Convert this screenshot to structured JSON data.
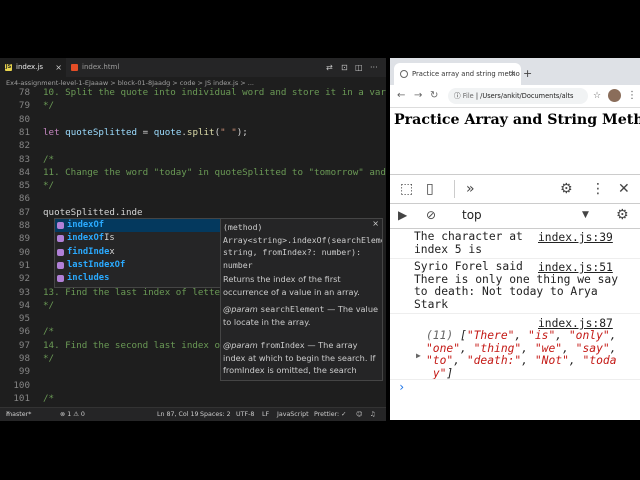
{
  "vscode": {
    "tabs": [
      "index.js",
      "index.html"
    ],
    "breadcrumb": "Ex4-assignment-level-1-EJaaaw  >  block-01-8Jaadg  >  code  >  JS  index.js  >  ...",
    "lines": [
      {
        "n": "78",
        "t": "10. Split the quote into individual word and store it in a vari"
      },
      {
        "n": "79",
        "t": "*/"
      },
      {
        "n": "80",
        "t": ""
      },
      {
        "n": "81",
        "t": ""
      },
      {
        "n": "82",
        "t": ""
      },
      {
        "n": "83",
        "t": "/*"
      },
      {
        "n": "84",
        "t": "11. Change the word \"today\" in quoteSplitted to \"tomorrow\" and"
      },
      {
        "n": "85",
        "t": "*/"
      },
      {
        "n": "86",
        "t": ""
      },
      {
        "n": "87",
        "t": "quoteSplitted.inde"
      },
      {
        "n": "88",
        "t": ""
      },
      {
        "n": "89",
        "t": ""
      },
      {
        "n": "90",
        "t": ""
      },
      {
        "n": "91",
        "t": ""
      },
      {
        "n": "92",
        "t": ""
      },
      {
        "n": "93",
        "t": "13. Find the last index of lette"
      },
      {
        "n": "94",
        "t": "*/"
      },
      {
        "n": "95",
        "t": ""
      },
      {
        "n": "96",
        "t": "/*"
      },
      {
        "n": "97",
        "t": "14. Find the second last index of"
      },
      {
        "n": "98",
        "t": "*/"
      },
      {
        "n": "99",
        "t": ""
      },
      {
        "n": "100",
        "t": ""
      },
      {
        "n": "101",
        "t": "/*"
      }
    ],
    "line81": {
      "kw": "let",
      "var": "quoteSplitted",
      "eq": " = ",
      "obj": "quote",
      "dot": ".",
      "fn": "split",
      "open": "(",
      "str": "\" \"",
      "close": ");"
    },
    "suggestions": [
      {
        "hl": "indexOf",
        "rest": ""
      },
      {
        "hl": "indexOf",
        "rest": "Is"
      },
      {
        "hl": "findInde",
        "rest": "x"
      },
      {
        "hl": "lastIndexOf",
        "rest": ""
      },
      {
        "hl": "includes",
        "rest": ""
      }
    ],
    "doc": {
      "signature": "(method) Array<string>.indexOf(searchElement: string, fromIndex?: number): number",
      "desc": "Returns the index of the first occurrence of a value in an array.",
      "p1_tag": "@param",
      "p1_name": "searchElement",
      "p1_desc": " — The value to locate in the array.",
      "p2_tag": "@param",
      "p2_name": "fromIndex",
      "p2_desc": " — The array index at which to begin the search. If fromIndex is omitted, the search starts"
    },
    "status": {
      "branch": "master*",
      "problems": "⊗ 1 ⚠ 0",
      "position": "Ln 87, Col 19",
      "spaces": "Spaces: 2",
      "encoding": "UTF-8",
      "eol": "LF",
      "language": "JavaScript",
      "prettier": "Prettier: ✓"
    }
  },
  "chrome": {
    "tab_title": "Practice array and string metho",
    "url_prefix": "File",
    "url": "/Users/ankit/Documents/alts",
    "page_heading": "Practice Array and String Methods",
    "devtools": {
      "context": "top",
      "console": [
        {
          "text": "The character at\nindex 5 is",
          "link": "index.js:39"
        },
        {
          "text": "Syrio Forel said\nThere is only one thing we say\nto death: Not today to Arya\nStark",
          "link": "index.js:51"
        }
      ],
      "array_link": "index.js:87",
      "array_count": "(11)",
      "array_items": [
        "\"There\"",
        "\"is\"",
        "\"only\"",
        "\"one\"",
        "\"thing\"",
        "\"we\"",
        "\"say\"",
        "\"to\"",
        "\"death:\"",
        "\"Not\"",
        "\"toda\n y\""
      ]
    }
  },
  "colors": {
    "editor_bg": "#1e1e1e",
    "accent": "#2aaaff",
    "keyword": "#c586c0",
    "string": "#ce9178",
    "comment": "#6a9955"
  }
}
